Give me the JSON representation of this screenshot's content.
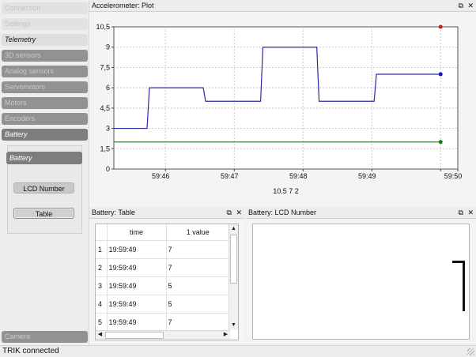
{
  "sidebar": {
    "items": [
      {
        "label": "Connection"
      },
      {
        "label": "Settings"
      },
      {
        "label": "Telemetry"
      },
      {
        "label": "3D sensors"
      },
      {
        "label": "Analog sensors"
      },
      {
        "label": "Servomotors"
      },
      {
        "label": "Motors"
      },
      {
        "label": "Encoders"
      },
      {
        "label": "Battery"
      }
    ],
    "battery_panel": {
      "sub_item": "Battery",
      "lcd_button": "LCD Number",
      "table_button": "Table"
    },
    "camera": "Camera"
  },
  "plot_panel": {
    "title": "Accelerometer: Plot",
    "float_icon": "⧉",
    "close_icon": "✕",
    "bottom_label": "10.5 7 2"
  },
  "chart_data": {
    "type": "line",
    "ylim": [
      0,
      10.5
    ],
    "yticks": [
      0,
      1.5,
      3,
      4.5,
      6,
      7.5,
      9,
      10.5
    ],
    "ytick_labels": [
      "0",
      "1,5",
      "3",
      "4,5",
      "6",
      "7,5",
      "9",
      "10,5"
    ],
    "xlim": [
      0,
      300
    ],
    "xticks_seconds": [
      45,
      105,
      165,
      225,
      285,
      300
    ],
    "xtick_labels": [
      "59:46",
      "59:47",
      "59:48",
      "59:49",
      "59:50"
    ],
    "xtick_label_positions": [
      45,
      105,
      165,
      225,
      300
    ],
    "grid": true,
    "series": [
      {
        "color": "#2a2aa6",
        "x": [
          0,
          29,
          31,
          78,
          80,
          128,
          130,
          177,
          179,
          227,
          229,
          275,
          277,
          285
        ],
        "y": [
          3,
          3,
          6,
          6,
          5,
          5,
          9,
          9,
          5,
          5,
          7,
          7,
          7,
          7
        ],
        "end_marker_color": "#1010c0"
      },
      {
        "color": "#1a9a1a",
        "x": [
          0,
          285
        ],
        "y": [
          2,
          2
        ],
        "end_marker_color": "#0a7a0a"
      },
      {
        "color": "#c02020",
        "x": [
          285
        ],
        "y": [
          10.5
        ],
        "end_marker_color": "#c02020"
      }
    ]
  },
  "table_panel": {
    "title": "Battery: Table",
    "float_icon": "⧉",
    "close_icon": "✕",
    "columns": [
      "time",
      "1 value"
    ],
    "rows": [
      {
        "n": "1",
        "time": "19:59:49",
        "value": "7"
      },
      {
        "n": "2",
        "time": "19:59:49",
        "value": "7"
      },
      {
        "n": "3",
        "time": "19:59:49",
        "value": "5"
      },
      {
        "n": "4",
        "time": "19:59:49",
        "value": "5"
      },
      {
        "n": "5",
        "time": "19:59:49",
        "value": "7"
      }
    ]
  },
  "lcd_panel": {
    "title": "Battery: LCD Number",
    "float_icon": "⧉",
    "close_icon": "✕",
    "value": "7"
  },
  "status": {
    "text": "TRIK connected"
  }
}
